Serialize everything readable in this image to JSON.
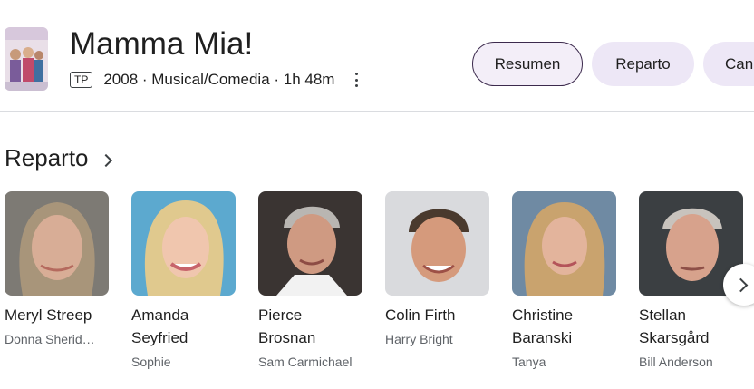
{
  "movie": {
    "title": "Mamma Mia!",
    "rating": "TP",
    "meta": "2008 · Musical/Comedia · 1h 48m"
  },
  "tabs": [
    {
      "label": "Resumen"
    },
    {
      "label": "Reparto"
    },
    {
      "label": "Can"
    }
  ],
  "cast_section": {
    "title": "Reparto"
  },
  "cast": [
    {
      "name": "Meryl Streep",
      "role": "Donna Sherid…"
    },
    {
      "name": "Amanda Seyfried",
      "role": "Sophie"
    },
    {
      "name": "Pierce Brosnan",
      "role": "Sam Carmichael"
    },
    {
      "name": "Colin Firth",
      "role": "Harry Bright"
    },
    {
      "name": "Christine Baranski",
      "role": "Tanya"
    },
    {
      "name": "Stellan Skarsgård",
      "role": "Bill Anderson"
    }
  ],
  "icons": {
    "more": "more-vert-icon",
    "next": "chevron-right-icon",
    "section": "chevron-right-icon"
  },
  "colors": {
    "active_tab_bg": "#f3eef8",
    "tab_bg": "#ede7f6",
    "divider": "#dadce0"
  }
}
